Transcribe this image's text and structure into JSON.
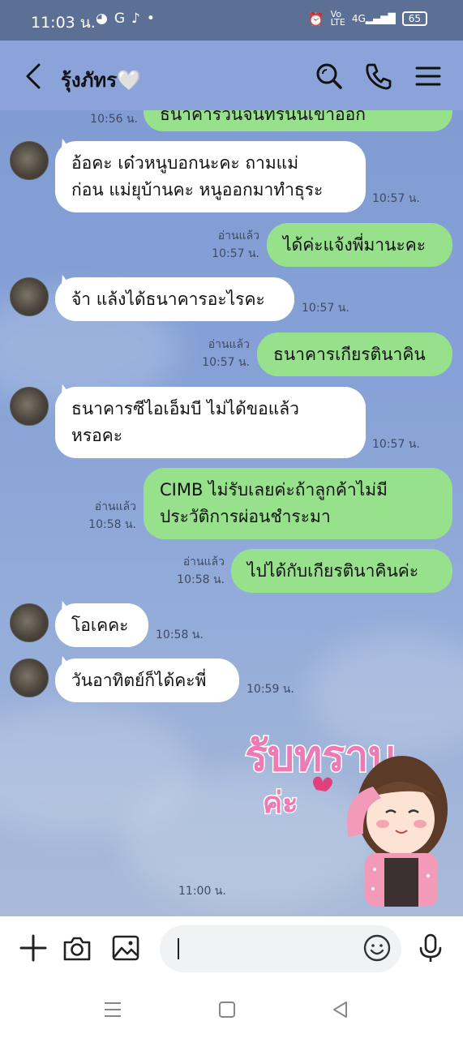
{
  "status_bar": {
    "time": "11:03 น.",
    "left_icons": [
      "messenger-icon",
      "g-icon",
      "tiktok-icon",
      "dot-icon"
    ],
    "right_icons": [
      "alarm-icon",
      "volte-icon",
      "4g-signal-icon"
    ],
    "battery": "65"
  },
  "header": {
    "contact_name": "รุ้งภัทร🤍",
    "icons": [
      "back-icon",
      "search-icon",
      "phone-icon",
      "menu-icon"
    ]
  },
  "messages": [
    {
      "id": "m0",
      "dir": "out",
      "text": "ธนาคารวันจันทร์นั้นเข้าออก",
      "time": "10:56 น.",
      "read": ""
    },
    {
      "id": "m1",
      "dir": "in",
      "line1": "อ้อคะ เด๋วหนูบอกนะคะ ถามแม่",
      "line2": "ก่อน แม่ยุบ้านคะ หนูออกมาทำธุระ",
      "time": "10:57 น."
    },
    {
      "id": "m2",
      "dir": "out",
      "text": "ได้ค่ะแจ้งพี่มานะคะ",
      "time": "10:57 น.",
      "read": "อ่านแล้ว"
    },
    {
      "id": "m3",
      "dir": "in",
      "text": "จ้า แล้งได้ธนาคารอะไรคะ",
      "time": "10:57 น."
    },
    {
      "id": "m4",
      "dir": "out",
      "text": "ธนาคารเกียรตินาคิน",
      "time": "10:57 น.",
      "read": "อ่านแล้ว"
    },
    {
      "id": "m5",
      "dir": "in",
      "line1": "ธนาคารซีไอเอ็มบี ไม่ได้ขอแล้ว",
      "line2": "หรอคะ",
      "time": "10:57 น."
    },
    {
      "id": "m6",
      "dir": "out",
      "line1": "CIMB ไม่รับเลยค่ะถ้าลูกค้าไม่มี",
      "line2": "ประวัติการผ่อนชำระมา",
      "time": "10:58 น.",
      "read": "อ่านแล้ว"
    },
    {
      "id": "m7",
      "dir": "out",
      "text": "ไปได้กับเกียรตินาคินค่ะ",
      "time": "10:58 น.",
      "read": "อ่านแล้ว"
    },
    {
      "id": "m8",
      "dir": "in",
      "text": "โอเคคะ",
      "time": "10:58 น."
    },
    {
      "id": "m9",
      "dir": "in",
      "text": "วันอาทิตย์ก็ได้คะพี่",
      "time": "10:59 น."
    }
  ],
  "sticker": {
    "caption": "รับทราบ",
    "sub": "ค่ะ",
    "time": "11:00 น."
  },
  "input_bar": {
    "placeholder": "",
    "icons": [
      "plus-icon",
      "camera-icon",
      "image-icon",
      "emoji-icon",
      "mic-icon"
    ]
  },
  "nav_bar": {
    "icons": [
      "recent-apps-icon",
      "home-icon",
      "back-nav-icon"
    ]
  }
}
